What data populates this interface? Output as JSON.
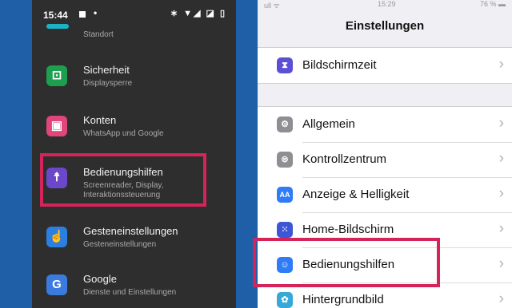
{
  "android": {
    "status": {
      "time": "15:44",
      "dot": "•",
      "icons": "∗ ▼◢ ◪ ▯"
    },
    "partial_item": {
      "subtitle": "Standort"
    },
    "items": [
      {
        "title": "Sicherheit",
        "subtitle": "Displaysperre",
        "icon": "unlock-icon",
        "glyph": "⊡",
        "color": "#1e9e4f"
      },
      {
        "title": "Konten",
        "subtitle": "WhatsApp und Google",
        "icon": "account-icon",
        "glyph": "▣",
        "color": "#e0457b"
      },
      {
        "title": "Bedienungshilfen",
        "subtitle": "Screenreader, Display,",
        "subtitle2": "Interaktionssteuerung",
        "icon": "accessibility-icon",
        "glyph": "☨",
        "color": "#6b47c9"
      },
      {
        "title": "Gesteneinstellungen",
        "subtitle": "Gesteneinstellungen",
        "icon": "gesture-icon",
        "glyph": "☝",
        "color": "#2a7fe0"
      },
      {
        "title": "Google",
        "subtitle": "Dienste und Einstellungen",
        "icon": "google-icon",
        "glyph": "G",
        "color": "#3b7be0"
      }
    ]
  },
  "ios": {
    "status": {
      "left": "ull ᯤ",
      "center": "15:29",
      "right": "76 % ▬"
    },
    "title": "Einstellungen",
    "group1": [
      {
        "label": "Bildschirmzeit",
        "icon": "hourglass-icon",
        "glyph": "⧗",
        "color": "#5b4fd6"
      }
    ],
    "group2": [
      {
        "label": "Allgemein",
        "icon": "gear-icon",
        "glyph": "⚙",
        "color": "#8e8e93"
      },
      {
        "label": "Kontrollzentrum",
        "icon": "toggles-icon",
        "glyph": "⊜",
        "color": "#8e8e93"
      },
      {
        "label": "Anzeige & Helligkeit",
        "icon": "display-icon",
        "glyph": "AA",
        "color": "#2f7cf6"
      },
      {
        "label": "Home-Bildschirm",
        "icon": "grid-icon",
        "glyph": "⁙",
        "color": "#3d56d6"
      },
      {
        "label": "Bedienungshilfen",
        "icon": "accessibility-icon",
        "glyph": "☺",
        "color": "#2f7cf6"
      },
      {
        "label": "Hintergrundbild",
        "icon": "wallpaper-icon",
        "glyph": "✿",
        "color": "#36a9d9"
      }
    ],
    "chevron": "›"
  }
}
